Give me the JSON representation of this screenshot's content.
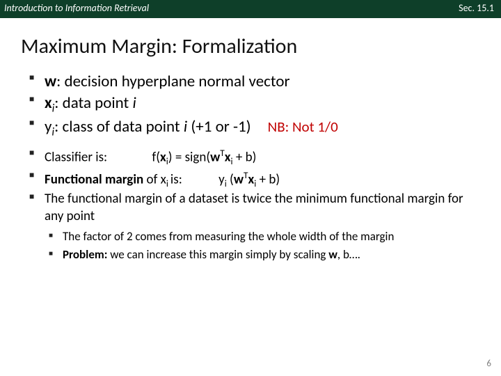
{
  "header": {
    "left": "Introduction to Information Retrieval",
    "right": "Sec. 15.1"
  },
  "title": "Maximum Margin: Formalization",
  "b1_pre": "w",
  "b1_post": ": decision hyperplane normal vector",
  "b2_pre": "x",
  "b2_sub": "i",
  "b2_post": ": data point ",
  "b2_post_i": "i",
  "b3_pre": "y",
  "b3_sub": "i",
  "b3_mid": ": class of data point ",
  "b3_i": "i",
  "b3_tail": " (+1 or -1)",
  "b3_nb": "NB: Not 1/0",
  "b4_label": "Classifier is:",
  "f_f": "f(",
  "f_x": "x",
  "f_i": "i",
  "f_mid": ") =  sign(",
  "f_wT": "w",
  "f_T": "T",
  "f_wTx": "x",
  "f_wTi": "i",
  "f_tail": " + b)",
  "b5_pre": "Functional margin",
  "b5_of": " of ",
  "b5_x": "x",
  "b5_i": "i ",
  "b5_is": "is:",
  "g_y": "y",
  "g_i": "i",
  "g_open": " (",
  "g_w": "w",
  "g_T": "T",
  "g_x": "x",
  "g_xi": "i",
  "g_tail": " + b)",
  "b6": "The functional margin of a dataset is twice the minimum functional margin for any point",
  "s1": "The factor of 2 comes from measuring the whole width of the margin",
  "s2_pre": "Problem:",
  "s2_mid": " we can increase this margin simply by scaling ",
  "s2_w": "w",
  "s2_tail": ", b….",
  "pagenum": "6"
}
